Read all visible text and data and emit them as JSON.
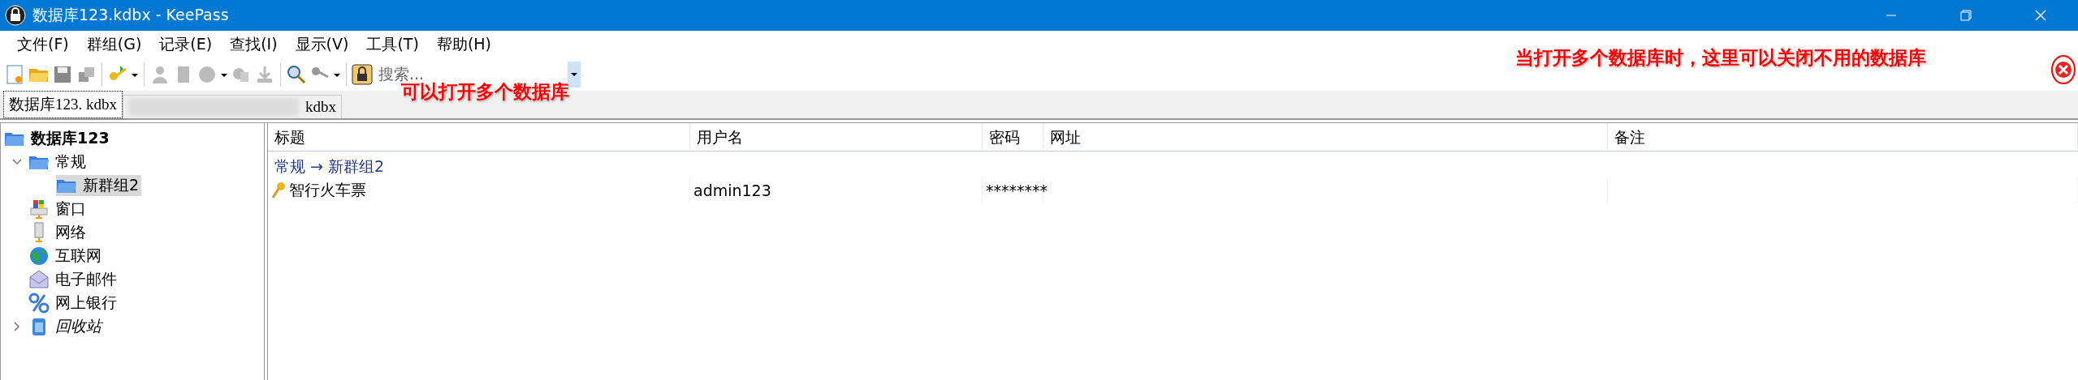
{
  "window": {
    "title": "数据库123.kdbx - KeePass"
  },
  "menu": [
    "文件(F)",
    "群组(G)",
    "记录(E)",
    "查找(I)",
    "显示(V)",
    "工具(T)",
    "帮助(H)"
  ],
  "search": {
    "placeholder": "搜索..."
  },
  "tabs": [
    {
      "label": "数据库123. kdbx",
      "selected": true,
      "blurred": false
    },
    {
      "label": "kdbx",
      "selected": false,
      "blurred": true
    }
  ],
  "annotations": [
    {
      "text": "可以打开多个数据库"
    },
    {
      "text": "当打开多个数据库时，这里可以关闭不用的数据库"
    }
  ],
  "tree": {
    "label": "数据库123",
    "children": [
      {
        "label": "常规",
        "kind": "group",
        "expanded": true,
        "selected": false,
        "children": [
          {
            "label": "新群组2",
            "selected": true
          }
        ]
      },
      {
        "label": "窗口",
        "kind": "group",
        "selected": false
      },
      {
        "label": "网络",
        "kind": "group",
        "selected": false
      },
      {
        "label": "互联网",
        "kind": "group",
        "selected": false
      },
      {
        "label": "电子邮件",
        "kind": "group",
        "selected": false
      },
      {
        "label": "网上银行",
        "kind": "group",
        "selected": false
      },
      {
        "label": "回收站",
        "kind": "recycle_bin",
        "expanded": false,
        "selected": false
      }
    ]
  },
  "table": {
    "columns": [
      "标题",
      "用户名",
      "密码",
      "网址",
      "备注"
    ],
    "rows": [
      {
        "kind": "group",
        "text": "常规 → 新群组2"
      },
      {
        "kind": "entry",
        "selected": false,
        "cells": [
          "智行火车票",
          "admin123",
          "********"
        ]
      }
    ]
  }
}
